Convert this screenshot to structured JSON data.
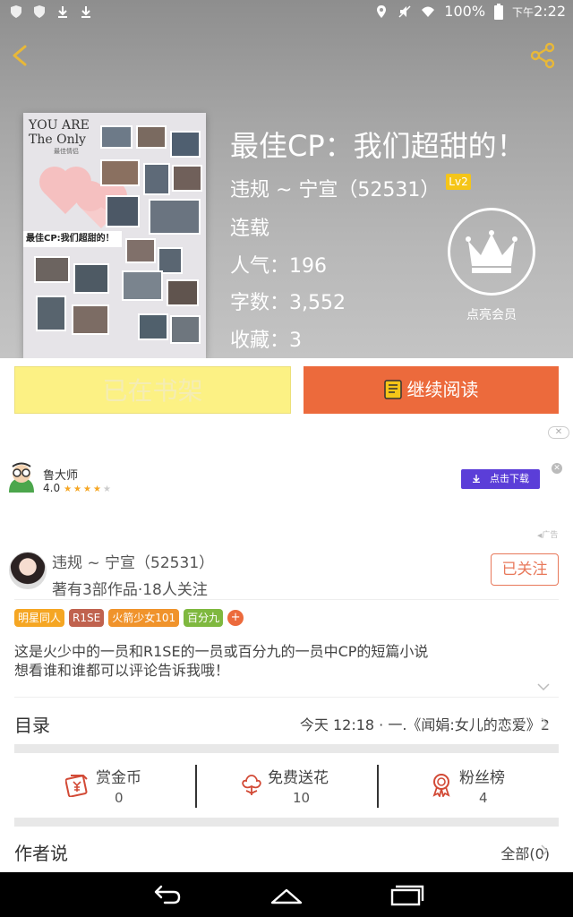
{
  "status_bar": {
    "battery": "100%",
    "time_prefix": "下午",
    "time": "2:22"
  },
  "book": {
    "title": "最佳CP：我们超甜的！",
    "author_line": "违规 ~ 宁宣（52531）",
    "level_badge": "Lv2",
    "status": "连载",
    "popularity": "人气：196",
    "word_count": "字数：3,552",
    "favorites": "收藏：3",
    "vip_label": "点亮会员",
    "cover": {
      "line1": "YOU ARE",
      "line2": "The Only",
      "small": "最佳情侣",
      "title": "最佳CP:我们超甜的！"
    }
  },
  "actions": {
    "shelf_label": "已在书架",
    "read_label": "继续阅读"
  },
  "ad": {
    "close_top": "✕",
    "app_name": "鲁大师",
    "rating": "4.0",
    "stars": "★★★★",
    "stars_off": "★",
    "download_label": "点击下载",
    "close": "✕",
    "tag": "广告"
  },
  "author": {
    "name": "违规 ~ 宁宣（52531）",
    "stats": "著有3部作品·18人关注",
    "follow_label": "已关注",
    "tags": [
      {
        "label": "明星同人",
        "color": "#f5a623"
      },
      {
        "label": "R1SE",
        "color": "#c0624e"
      },
      {
        "label": "火箭少女101",
        "color": "#f0932b"
      },
      {
        "label": "百分九",
        "color": "#7fb83f"
      }
    ],
    "tag_more": "+",
    "description_line1": "这是火少中的一员和R1SE的一员或百分九的一员中CP的短篇小说",
    "description_line2": "想看谁和谁都可以评论告诉我哦！"
  },
  "toc": {
    "label": "目录",
    "latest": "今天 12:18 · 一.《闻娟:女儿的恋爱》2"
  },
  "stats": [
    {
      "label": "赏金币",
      "value": "0",
      "icon": "coin-red-packet-icon"
    },
    {
      "label": "免费送花",
      "value": "10",
      "icon": "flower-icon"
    },
    {
      "label": "粉丝榜",
      "value": "4",
      "icon": "medal-icon"
    }
  ],
  "author_say": {
    "label": "作者说",
    "all_label": "全部(0)"
  },
  "colors": {
    "accent": "#ec6a3c",
    "shelf_button": "#fcf184",
    "ad_button": "#5b3ed8",
    "icon_red": "#d24a36"
  }
}
